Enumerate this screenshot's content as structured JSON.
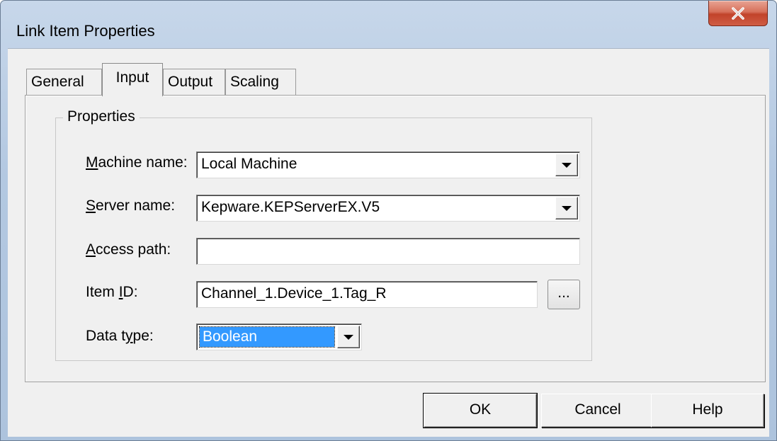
{
  "window": {
    "title": "Link Item Properties"
  },
  "tabs": [
    {
      "label": "General"
    },
    {
      "label": "Input"
    },
    {
      "label": "Output"
    },
    {
      "label": "Scaling"
    }
  ],
  "active_tab": "Input",
  "group": {
    "legend": "Properties"
  },
  "fields": {
    "machine_name": {
      "label_mnemonic": "M",
      "label_rest": "achine name:",
      "value": "Local Machine"
    },
    "server_name": {
      "label_mnemonic": "S",
      "label_rest": "erver name:",
      "value": "Kepware.KEPServerEX.V5"
    },
    "access_path": {
      "label_mnemonic": "A",
      "label_rest": "ccess path:",
      "value": ""
    },
    "item_id": {
      "label_pre": "Item ",
      "label_mnemonic": "I",
      "label_rest": "D:",
      "value": "Channel_1.Device_1.Tag_R",
      "browse_label": "..."
    },
    "data_type": {
      "label_pre": "Data t",
      "label_mnemonic": "y",
      "label_rest": "pe:",
      "value": "Boolean"
    }
  },
  "buttons": {
    "ok": "OK",
    "cancel": "Cancel",
    "help": "Help"
  },
  "colors": {
    "selection": "#3399ff",
    "close_button": "#c2432a",
    "dialog_face": "#f0f0f0"
  },
  "icons": {
    "close": "close-icon",
    "dropdown": "chevron-down-icon"
  }
}
